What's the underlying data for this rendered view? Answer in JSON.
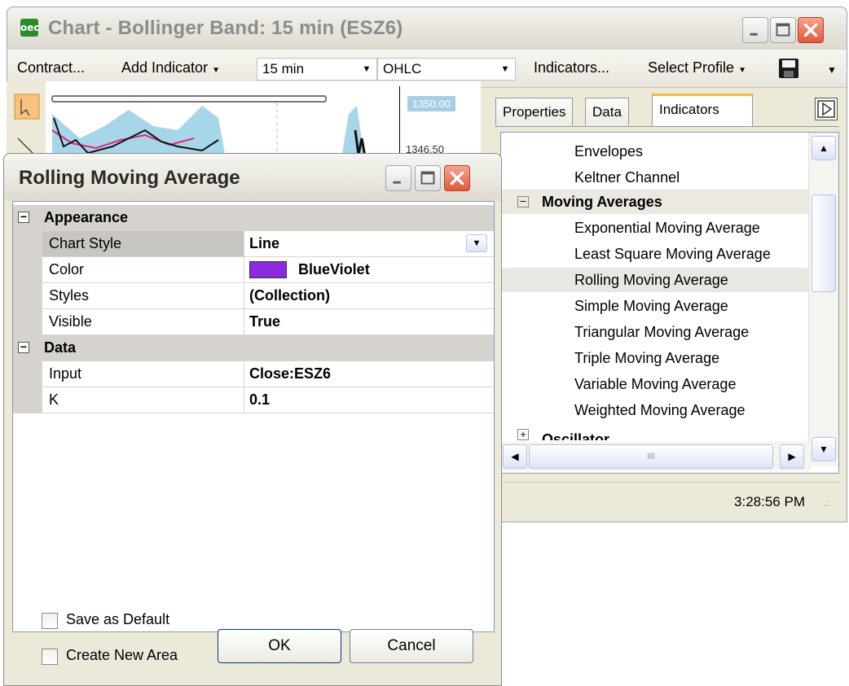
{
  "main_window": {
    "title": "Chart - Bollinger Band: 15 min (ESZ6)",
    "icon_text": "oec"
  },
  "toolbar": {
    "contract_label": "Contract...",
    "add_indicator_label": "Add Indicator",
    "interval_value": "15 min",
    "chart_type_value": "OHLC",
    "indicators_label": "Indicators...",
    "select_profile_label": "Select Profile"
  },
  "chart": {
    "price_top": "1350.00",
    "price_second": "1346.50"
  },
  "right_panel": {
    "tabs": [
      "Properties",
      "Data",
      "Indicators"
    ],
    "active_tab": "Indicators",
    "items": [
      {
        "label": "Envelopes"
      },
      {
        "label": "Keltner Channel"
      },
      {
        "label": "Moving Averages"
      },
      {
        "label": "Exponential Moving Average"
      },
      {
        "label": "Least Square Moving Average"
      },
      {
        "label": "Rolling Moving Average"
      },
      {
        "label": "Simple Moving Average"
      },
      {
        "label": "Triangular Moving Average"
      },
      {
        "label": "Triple Moving Average"
      },
      {
        "label": "Variable Moving Average"
      },
      {
        "label": "Weighted Moving Average"
      },
      {
        "label": "Oscillator"
      }
    ],
    "selected_item": "Rolling Moving Average",
    "hscroll_grip": "III"
  },
  "status_bar": {
    "time": "3:28:56 PM"
  },
  "dialog": {
    "title": "Rolling Moving Average",
    "categories": [
      {
        "name": "Appearance",
        "properties": [
          {
            "key": "Chart Style",
            "value": "Line"
          },
          {
            "key": "Color",
            "value": "BlueViolet"
          },
          {
            "key": "Styles",
            "value": "(Collection)"
          },
          {
            "key": "Visible",
            "value": "True"
          }
        ]
      },
      {
        "name": "Data",
        "properties": [
          {
            "key": "Input",
            "value": "Close:ESZ6"
          },
          {
            "key": "K",
            "value": "0.1"
          }
        ]
      }
    ],
    "color_swatch": "#8a2be2",
    "save_default_label": "Save as Default",
    "create_area_label": "Create New Area",
    "ok_label": "OK",
    "cancel_label": "Cancel"
  }
}
